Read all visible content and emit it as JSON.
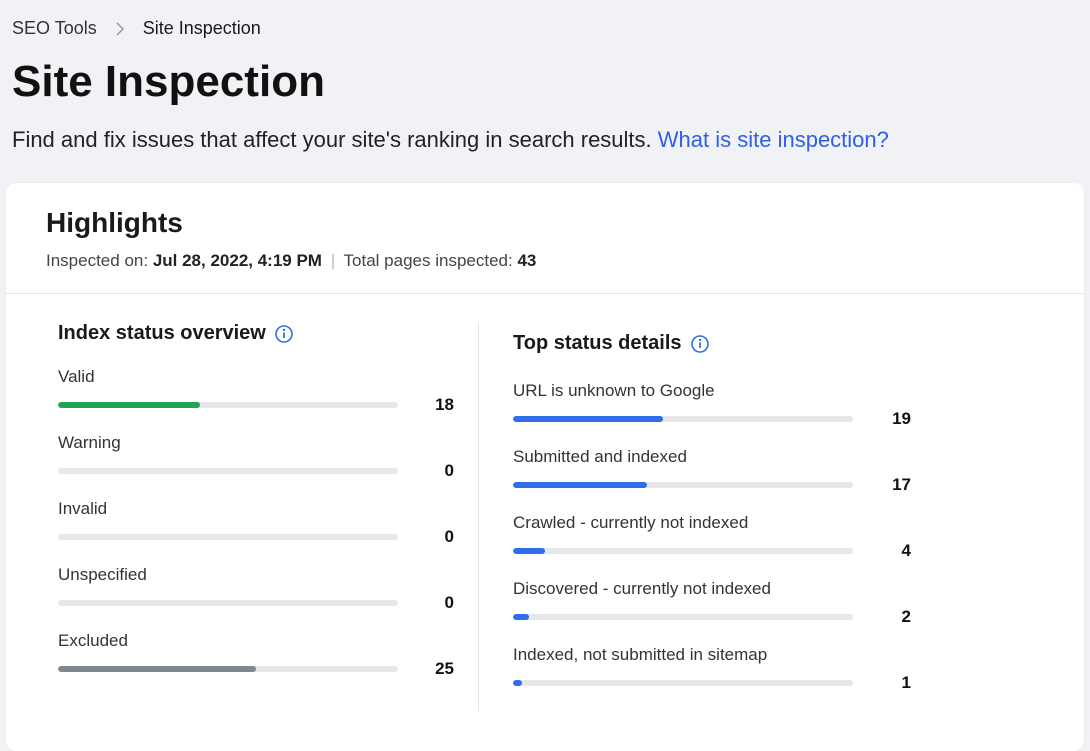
{
  "breadcrumb": {
    "parent": "SEO Tools",
    "current": "Site Inspection"
  },
  "page": {
    "title": "Site Inspection",
    "description": "Find and fix issues that affect your site's ranking in search results.",
    "help_link": "What is site inspection?"
  },
  "highlights": {
    "title": "Highlights",
    "inspected_label": "Inspected on:",
    "inspected_value": "Jul 28, 2022, 4:19 PM",
    "total_label": "Total pages inspected:",
    "total_value": "43"
  },
  "index_status": {
    "title": "Index status overview",
    "max": 43,
    "items": [
      {
        "label": "Valid",
        "value": 18,
        "color": "green"
      },
      {
        "label": "Warning",
        "value": 0,
        "color": "grey"
      },
      {
        "label": "Invalid",
        "value": 0,
        "color": "grey"
      },
      {
        "label": "Unspecified",
        "value": 0,
        "color": "grey"
      },
      {
        "label": "Excluded",
        "value": 25,
        "color": "grey"
      }
    ]
  },
  "top_status": {
    "title": "Top status details",
    "max": 43,
    "items": [
      {
        "label": "URL is unknown to Google",
        "value": 19,
        "color": "blue"
      },
      {
        "label": "Submitted and indexed",
        "value": 17,
        "color": "blue"
      },
      {
        "label": "Crawled - currently not indexed",
        "value": 4,
        "color": "blue"
      },
      {
        "label": "Discovered - currently not indexed",
        "value": 2,
        "color": "blue"
      },
      {
        "label": "Indexed, not submitted in sitemap",
        "value": 1,
        "color": "blue"
      }
    ]
  },
  "chart_data": [
    {
      "type": "bar",
      "title": "Index status overview",
      "categories": [
        "Valid",
        "Warning",
        "Invalid",
        "Unspecified",
        "Excluded"
      ],
      "values": [
        18,
        0,
        0,
        0,
        25
      ],
      "xlabel": "",
      "ylabel": "",
      "ylim": [
        0,
        43
      ]
    },
    {
      "type": "bar",
      "title": "Top status details",
      "categories": [
        "URL is unknown to Google",
        "Submitted and indexed",
        "Crawled - currently not indexed",
        "Discovered - currently not indexed",
        "Indexed, not submitted in sitemap"
      ],
      "values": [
        19,
        17,
        4,
        2,
        1
      ],
      "xlabel": "",
      "ylabel": "",
      "ylim": [
        0,
        43
      ]
    }
  ]
}
